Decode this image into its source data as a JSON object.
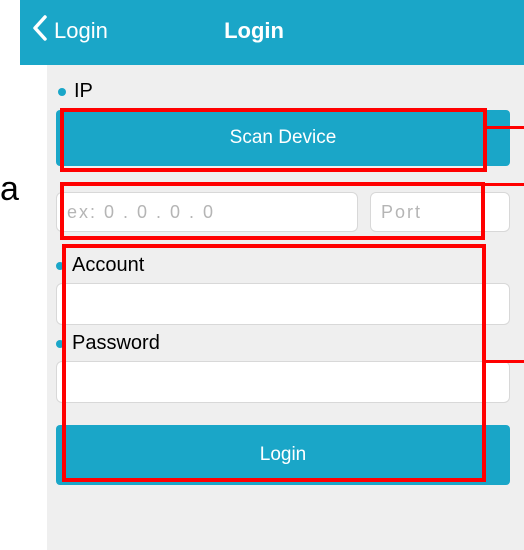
{
  "navbar": {
    "back_label": "Login",
    "title": "Login"
  },
  "ip_section": {
    "label": "IP",
    "scan_button": "Scan Device",
    "ip_placeholder": "ex: 0 . 0 . 0 . 0",
    "port_placeholder": "Port"
  },
  "account_section": {
    "label": "Account",
    "value": ""
  },
  "password_section": {
    "label": "Password",
    "value": ""
  },
  "login_button": "Login",
  "side_text": "a",
  "colors": {
    "accent": "#1aa6c8",
    "background": "#efefef",
    "highlight": "#ff0000"
  },
  "icons": [
    "chevron-left-icon"
  ]
}
